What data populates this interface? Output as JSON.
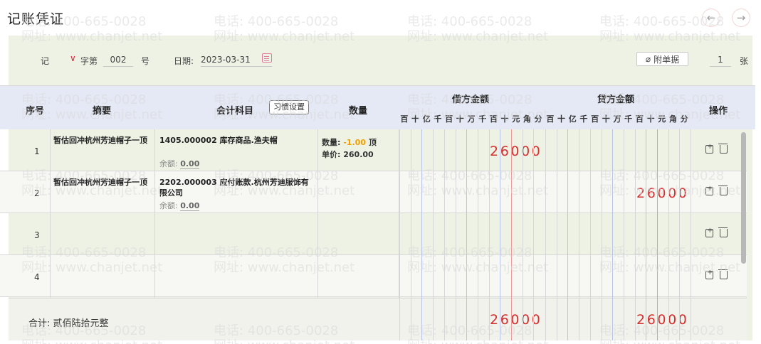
{
  "page": {
    "title": "记账凭证"
  },
  "header": {
    "voucher_type": "记",
    "word_label": "字第",
    "voucher_no": "002",
    "hao_label": "号",
    "date_label": "日期:",
    "date_value": "2023-03-31",
    "attach_label": "附单据",
    "attach_count": "1",
    "zhang_label": "张"
  },
  "table": {
    "headers": {
      "index": "序号",
      "summary": "摘要",
      "account": "会计科目",
      "habit_button": "习惯设置",
      "quantity": "数量",
      "debit": "借方金额",
      "credit": "贷方金额",
      "ops": "操作"
    },
    "digits": [
      "百",
      "十",
      "亿",
      "千",
      "百",
      "十",
      "万",
      "千",
      "百",
      "十",
      "元",
      "角",
      "分"
    ],
    "rows": [
      {
        "index": "1",
        "summary": "暂估回冲杭州芳迪帽子一顶",
        "account": "1405.000002 库存商品.渔夫帽",
        "balance_label": "余额:",
        "balance_value": "0.00",
        "qty_label": "数量:",
        "qty_value": "-1.00",
        "qty_unit": "顶",
        "price_label": "单价:",
        "price_value": "260.00",
        "debit": "26000",
        "credit": ""
      },
      {
        "index": "2",
        "summary": "暂估回冲杭州芳迪帽子一顶",
        "account": "2202.000003 应付账款.杭州芳迪服饰有限公司",
        "balance_label": "余额:",
        "balance_value": "0.00",
        "debit": "",
        "credit": "26000"
      },
      {
        "index": "3"
      },
      {
        "index": "4"
      }
    ],
    "total": {
      "label": "合计: 贰佰陆拾元整",
      "debit": "26000",
      "credit": "26000"
    }
  },
  "watermark": {
    "phone": "电话: 400-665-0028",
    "site": "网址: www.chanjet.net"
  },
  "icons": [
    "arrow-left-icon",
    "arrow-right-icon",
    "chevron-down-icon",
    "calendar-icon",
    "paperclip-icon",
    "copy-icon",
    "delete-icon"
  ],
  "colors": {
    "amount": "#d62f2f",
    "negative_qty": "#f0a000",
    "header_bg": "#e4e9f5",
    "panel_bg": "#eef2e5"
  }
}
